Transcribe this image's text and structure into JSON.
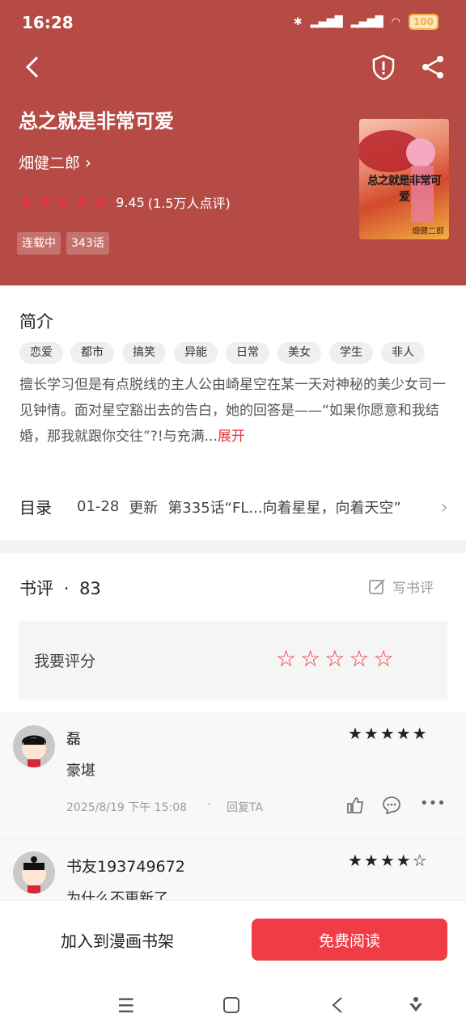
{
  "status_bar": {
    "time": "16:28",
    "battery": "100"
  },
  "book": {
    "title": "总之就是非常可爱",
    "author": "畑健二郎",
    "rating": "9.45",
    "rating_count": "(1.5万人点评)",
    "status_tag": "连载中",
    "chapters_tag": "343话",
    "cover_title": "总之就是非常可爱",
    "cover_author": "畑健二郎"
  },
  "intro": {
    "title": "简介",
    "genres": [
      "恋爱",
      "都市",
      "搞笑",
      "异能",
      "日常",
      "美女",
      "学生",
      "非人"
    ],
    "description": "擅长学习但是有点脱线的主人公由崎星空在某一天对神秘的美少女司一见钟情。面对星空豁出去的告白，她的回答是——“如果你愿意和我结婚，那我就跟你交往”?!与充满...",
    "expand_label": "展开"
  },
  "catalog": {
    "title": "目录",
    "date": "01-28",
    "update_label": "更新",
    "latest": "第335话“FL...向着星星，向着天空”"
  },
  "reviews": {
    "title": "书评",
    "count": "83",
    "write_label": "写书评",
    "rate_label": "我要评分",
    "comments": [
      {
        "user": "磊",
        "text": "豪堪",
        "time": "2025/8/19 下午 15:08",
        "reply": "回复TA",
        "stars": 5
      },
      {
        "user": "书友193749672",
        "text": "为什么不更新了",
        "stars": 4
      }
    ]
  },
  "bottom": {
    "shelf_label": "加入到漫画书架",
    "read_label": "免费阅读"
  }
}
